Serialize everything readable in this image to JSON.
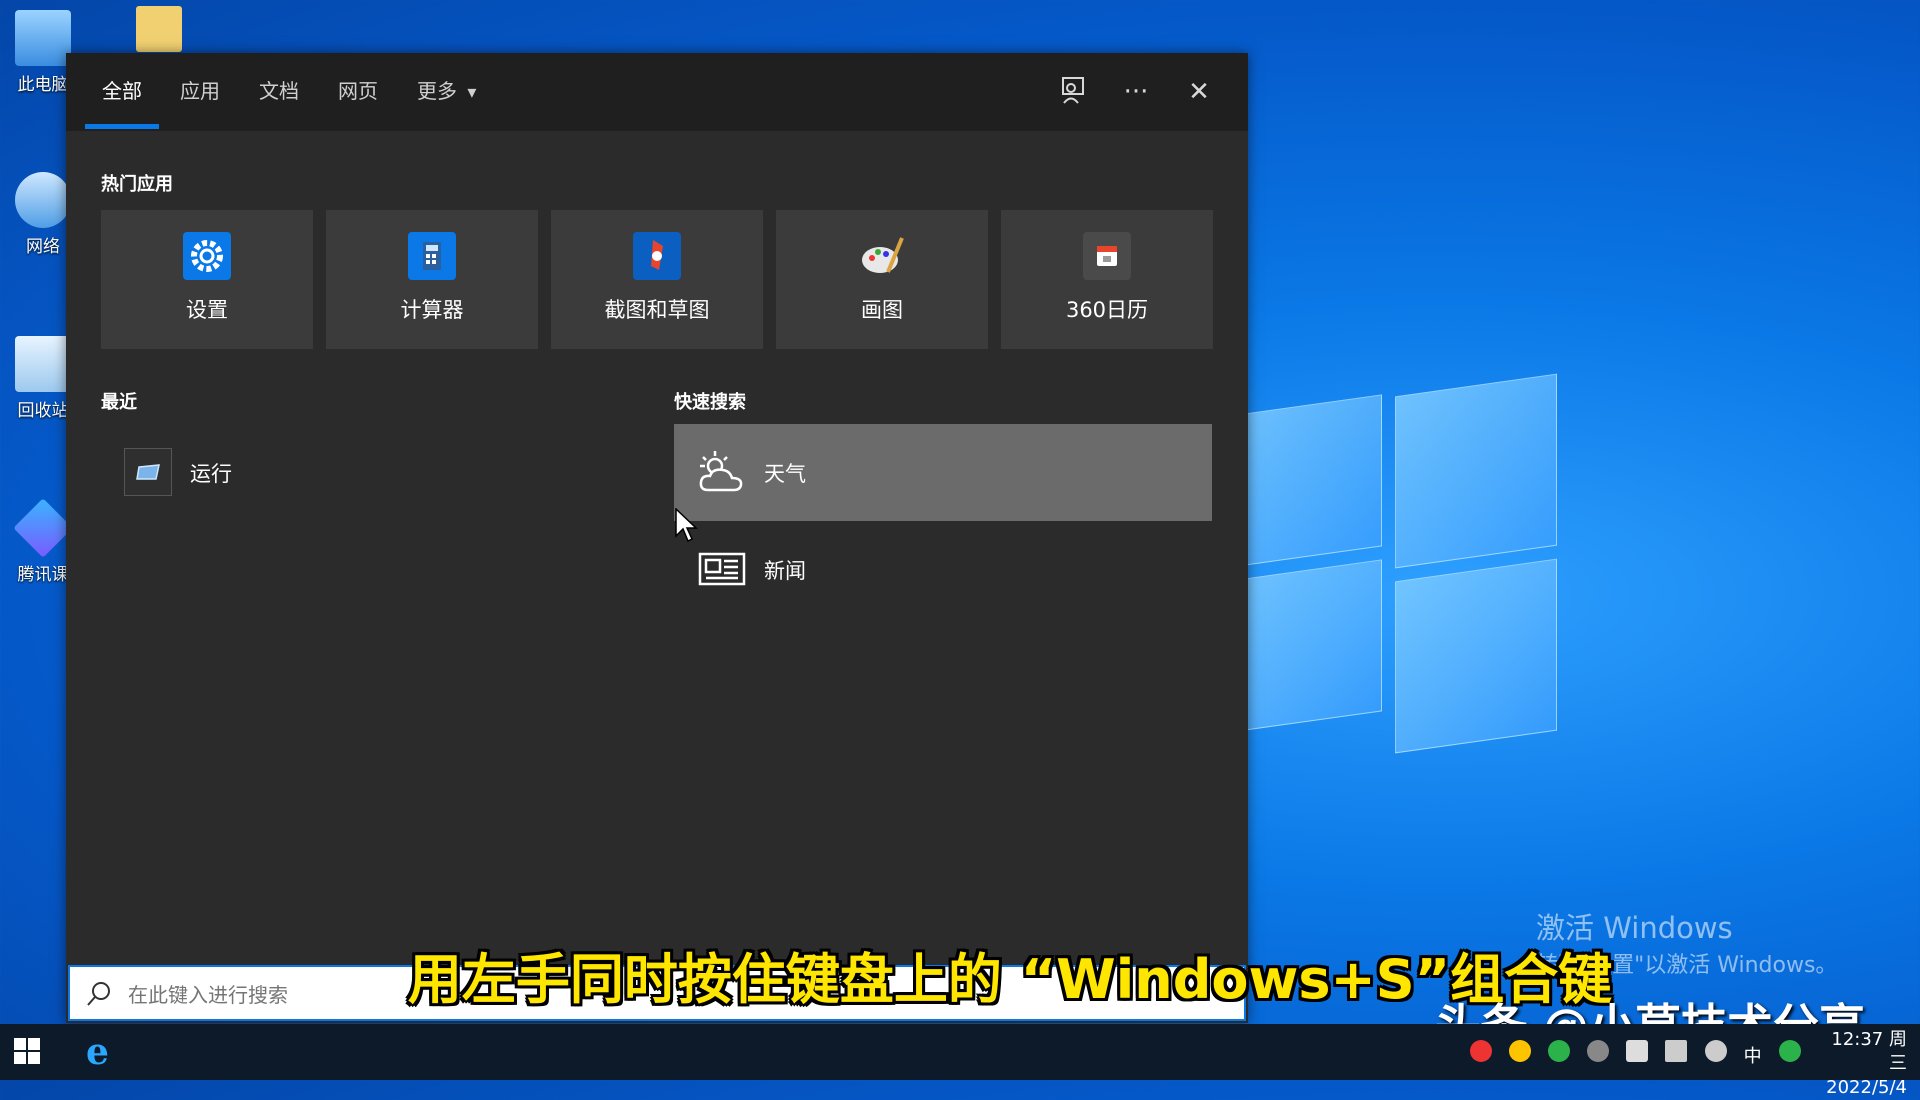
{
  "desktop": {
    "icons": [
      {
        "label": "此电脑"
      },
      {
        "label": "网络"
      },
      {
        "label": "回收站"
      },
      {
        "label": "腾讯课"
      }
    ],
    "watermark_title": "激活 Windows",
    "watermark_sub": "转到\"设置\"以激活 Windows。"
  },
  "search_panel": {
    "tabs": [
      {
        "label": "全部"
      },
      {
        "label": "应用"
      },
      {
        "label": "文档"
      },
      {
        "label": "网页"
      },
      {
        "label": "更多"
      }
    ],
    "more_caret": "▾",
    "ellipsis": "···",
    "close": "✕",
    "hot_apps_title": "热门应用",
    "hot_apps": [
      {
        "label": "设置",
        "icon": "gear-icon"
      },
      {
        "label": "计算器",
        "icon": "calculator-icon"
      },
      {
        "label": "截图和草图",
        "icon": "snip-icon"
      },
      {
        "label": "画图",
        "icon": "paint-icon"
      },
      {
        "label": "360日历",
        "icon": "calendar-icon"
      }
    ],
    "recent_title": "最近",
    "recent_items": [
      {
        "label": "运行",
        "icon": "run-icon"
      }
    ],
    "quick_search_title": "快速搜索",
    "quick_search": [
      {
        "label": "天气",
        "icon": "weather-icon"
      },
      {
        "label": "新闻",
        "icon": "news-icon"
      }
    ],
    "search_placeholder": "在此键入进行搜索"
  },
  "overlay": {
    "subtitle": "用左手同时按住键盘上的 “Windows+S”组合键",
    "brand": "头条 @小草技术分享"
  },
  "taskbar": {
    "ime": "中",
    "time": "12:37 周三",
    "date": "2022/5/4"
  },
  "colors": {
    "accent": "#0a78e6",
    "panel_bg": "#2b2b2b",
    "tile_bg": "#3b3b3b",
    "highlight_bg": "#6b6b6b",
    "subtitle": "#ffe600"
  }
}
